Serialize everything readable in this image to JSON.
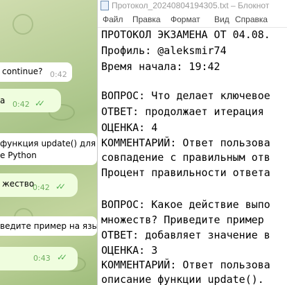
{
  "chat": {
    "messages": [
      {
        "kind": "in",
        "text": "continue?",
        "time": "0:42"
      },
      {
        "kind": "out",
        "text": "a",
        "time": "0:42"
      },
      {
        "kind": "in",
        "text": "функция update() для м",
        "text2": "e Python"
      },
      {
        "kind": "out",
        "text": "жество",
        "time": "0:42"
      },
      {
        "kind": "in",
        "text": "ведите пример на языке"
      },
      {
        "kind": "out",
        "text": "",
        "time": "0:43"
      }
    ]
  },
  "notepad": {
    "title": "Протокол_20240804194305.txt – Блокнот",
    "menu": [
      "Файл",
      "Правка",
      "Формат",
      "Вид",
      "Справка"
    ],
    "lines": [
      "ПРОТОКОЛ ЭКЗАМЕНА ОТ 04.08.",
      "Профиль: @aleksmir74",
      "Время начала: 19:42",
      "",
      "ВОПРОС: Что делает ключевое",
      "ОТВЕТ: продолжает итерация",
      "ОЦЕНКА: 4",
      "КОММЕНТАРИЙ: Ответ пользова",
      "совпадение с правильным отв",
      "Процент правильности ответа",
      "",
      "ВОПРОС: Какое действие выпо",
      "множеств? Приведите пример",
      "ОТВЕТ: добавляет значение в",
      "ОЦЕНКА: 3",
      "КОММЕНТАРИЙ: Ответ пользова",
      "описание функции update()."
    ]
  }
}
